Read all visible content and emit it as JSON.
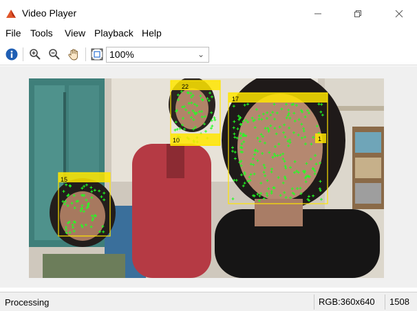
{
  "window": {
    "title": "Video Player",
    "icon": "matlab-icon",
    "controls": [
      "minimize-icon",
      "maximize-icon",
      "close-icon"
    ]
  },
  "menu": {
    "items": [
      "File",
      "Tools",
      "View",
      "Playback",
      "Help"
    ]
  },
  "toolbar": {
    "buttons": [
      "info-icon",
      "zoom-in-icon",
      "zoom-out-icon",
      "pan-hand-icon",
      "fit-to-window-icon"
    ],
    "zoom_value": "100%"
  },
  "video": {
    "detections": [
      {
        "label": "15"
      },
      {
        "label": "22"
      },
      {
        "label": "10"
      },
      {
        "label": "17"
      },
      {
        "label": "1"
      }
    ],
    "box_color": "#ffe600",
    "point_color": "#22ff22"
  },
  "status": {
    "text": "Processing",
    "image_info": "RGB:360x640",
    "frame_number": "1508"
  }
}
